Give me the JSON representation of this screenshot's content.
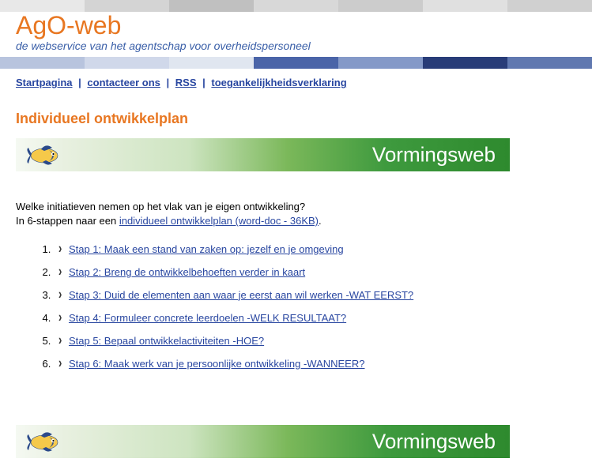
{
  "header": {
    "title": "AgO-web",
    "subtitle": "de webservice van het agentschap voor overheidspersoneel"
  },
  "nav": {
    "items": [
      {
        "label": "Startpagina"
      },
      {
        "label": "contacteer ons"
      },
      {
        "label": "RSS"
      },
      {
        "label": "toegankelijkheidsverklaring"
      }
    ],
    "separator": "|"
  },
  "page": {
    "title": "Individueel ontwikkelplan"
  },
  "banner": {
    "title": "Vormingsweb"
  },
  "intro": {
    "line1": "Welke initiatieven nemen op het vlak van je eigen ontwikkeling?",
    "line2_prefix": "In 6-stappen naar een ",
    "line2_link": "individueel ontwikkelplan (word-doc - 36KB)",
    "line2_suffix": "."
  },
  "steps": [
    {
      "label": "Stap 1: Maak een stand van zaken op: jezelf en je omgeving"
    },
    {
      "label": "Stap 2: Breng de ontwikkelbehoeften verder in kaart"
    },
    {
      "label": "Stap 3: Duid de elementen aan waar je eerst aan wil werken -WAT EERST?"
    },
    {
      "label": "Stap 4: Formuleer concrete leerdoelen -WELK RESULTAAT?"
    },
    {
      "label": "Stap 5: Bepaal ontwikkelactiviteiten -HOE?"
    },
    {
      "label": "Stap 6: Maak werk van je persoonlijke ontwikkeling -WANNEER?"
    }
  ]
}
